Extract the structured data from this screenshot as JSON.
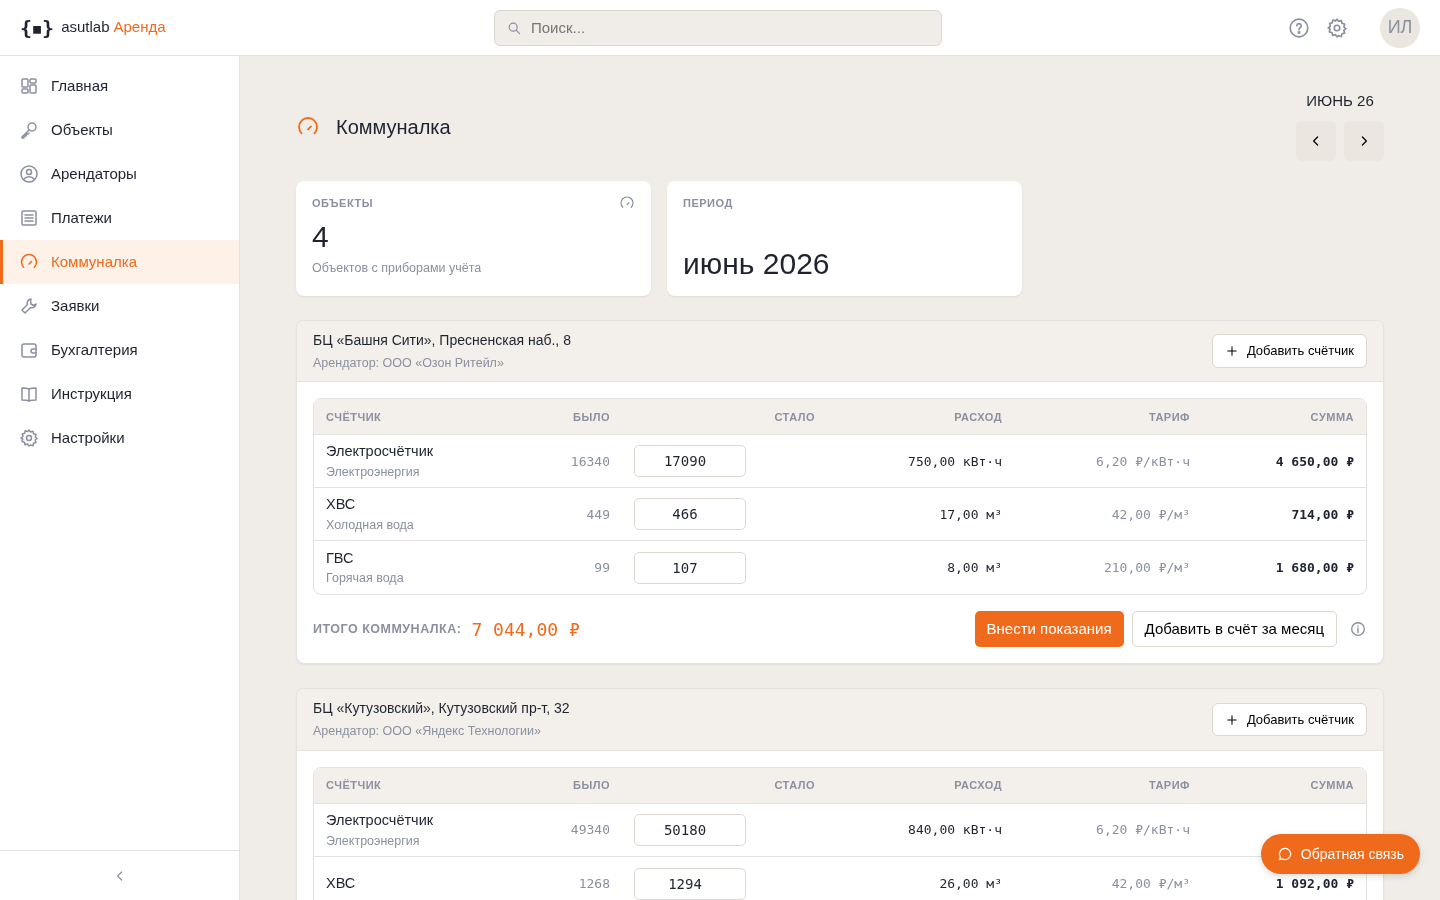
{
  "header": {
    "logo_mark": "{▪}",
    "brand": "asutlab",
    "product": "Аренда",
    "search": {
      "placeholder": "Поиск..."
    },
    "user_initials": "ИЛ"
  },
  "sidebar": {
    "items": [
      {
        "label": "Главная",
        "kind": "grid",
        "selected": false
      },
      {
        "label": "Объекты",
        "kind": "key",
        "selected": false
      },
      {
        "label": "Арендаторы",
        "kind": "user",
        "selected": false
      },
      {
        "label": "Платежи",
        "kind": "list",
        "selected": false
      },
      {
        "label": "Коммуналка",
        "kind": "gauge",
        "selected": true
      },
      {
        "label": "Заявки",
        "kind": "wrench",
        "selected": false
      },
      {
        "label": "Бухгалтерия",
        "kind": "wallet",
        "selected": false
      },
      {
        "label": "Инструкция",
        "kind": "book",
        "selected": false
      },
      {
        "label": "Настройки",
        "kind": "gear",
        "selected": false
      }
    ]
  },
  "page": {
    "title": "Коммуналка",
    "period_label": "ИЮНЬ 26"
  },
  "stats": [
    {
      "label": "ОБЪЕКТЫ",
      "value": "4",
      "caption": "Объектов с приборами учёта",
      "kind": "count"
    },
    {
      "label": "ПЕРИОД",
      "value": "июнь 2026",
      "kind": "period"
    }
  ],
  "objects": [
    {
      "title": "БЦ «Башня Сити», Пресненская наб., 8",
      "tenant": "Арендатор: ООО «Озон Ритейл»",
      "add_button": "Добавить счётчик",
      "columns": [
        "СЧЁТЧИК",
        "БЫЛО",
        "СТАЛО",
        "РАСХОД",
        "ТАРИФ",
        "СУММА"
      ],
      "meters": [
        {
          "name": "Электросчётчик",
          "type": "Электроэнергия",
          "before": "16340",
          "after": "17090",
          "usage": "750,00 кВт·ч",
          "tariff": "6,20 ₽/кВт·ч",
          "sum": "4 650,00 ₽"
        },
        {
          "name": "ХВС",
          "type": "Холодная вода",
          "before": "449",
          "after": "466",
          "usage": "17,00 м³",
          "tariff": "42,00 ₽/м³",
          "sum": "714,00 ₽"
        },
        {
          "name": "ГВС",
          "type": "Горячая вода",
          "before": "99",
          "after": "107",
          "usage": "8,00 м³",
          "tariff": "210,00 ₽/м³",
          "sum": "1 680,00 ₽"
        }
      ],
      "total_label": "ИТОГО КОММУНАЛКА:",
      "total": "7 044,00 ₽",
      "primary_button": "Внести показания",
      "secondary_button": "Добавить в счёт за месяц"
    },
    {
      "title": "БЦ «Кутузовский», Кутузовский пр-т, 32",
      "tenant": "Арендатор: ООО «Яндекс Технологии»",
      "add_button": "Добавить счётчик",
      "columns": [
        "СЧЁТЧИК",
        "БЫЛО",
        "СТАЛО",
        "РАСХОД",
        "ТАРИФ",
        "СУММА"
      ],
      "meters": [
        {
          "name": "Электросчётчик",
          "type": "Электроэнергия",
          "before": "49340",
          "after": "50180",
          "usage": "840,00 кВт·ч",
          "tariff": "6,20 ₽/кВт·ч"
        },
        {
          "name": "ХВС",
          "before": "1268",
          "after": "1294",
          "usage": "26,00 м³",
          "tariff": "42,00 ₽/м³",
          "sum": "1 092,00 ₽"
        }
      ]
    }
  ],
  "feedback_button": "Обратная связь"
}
